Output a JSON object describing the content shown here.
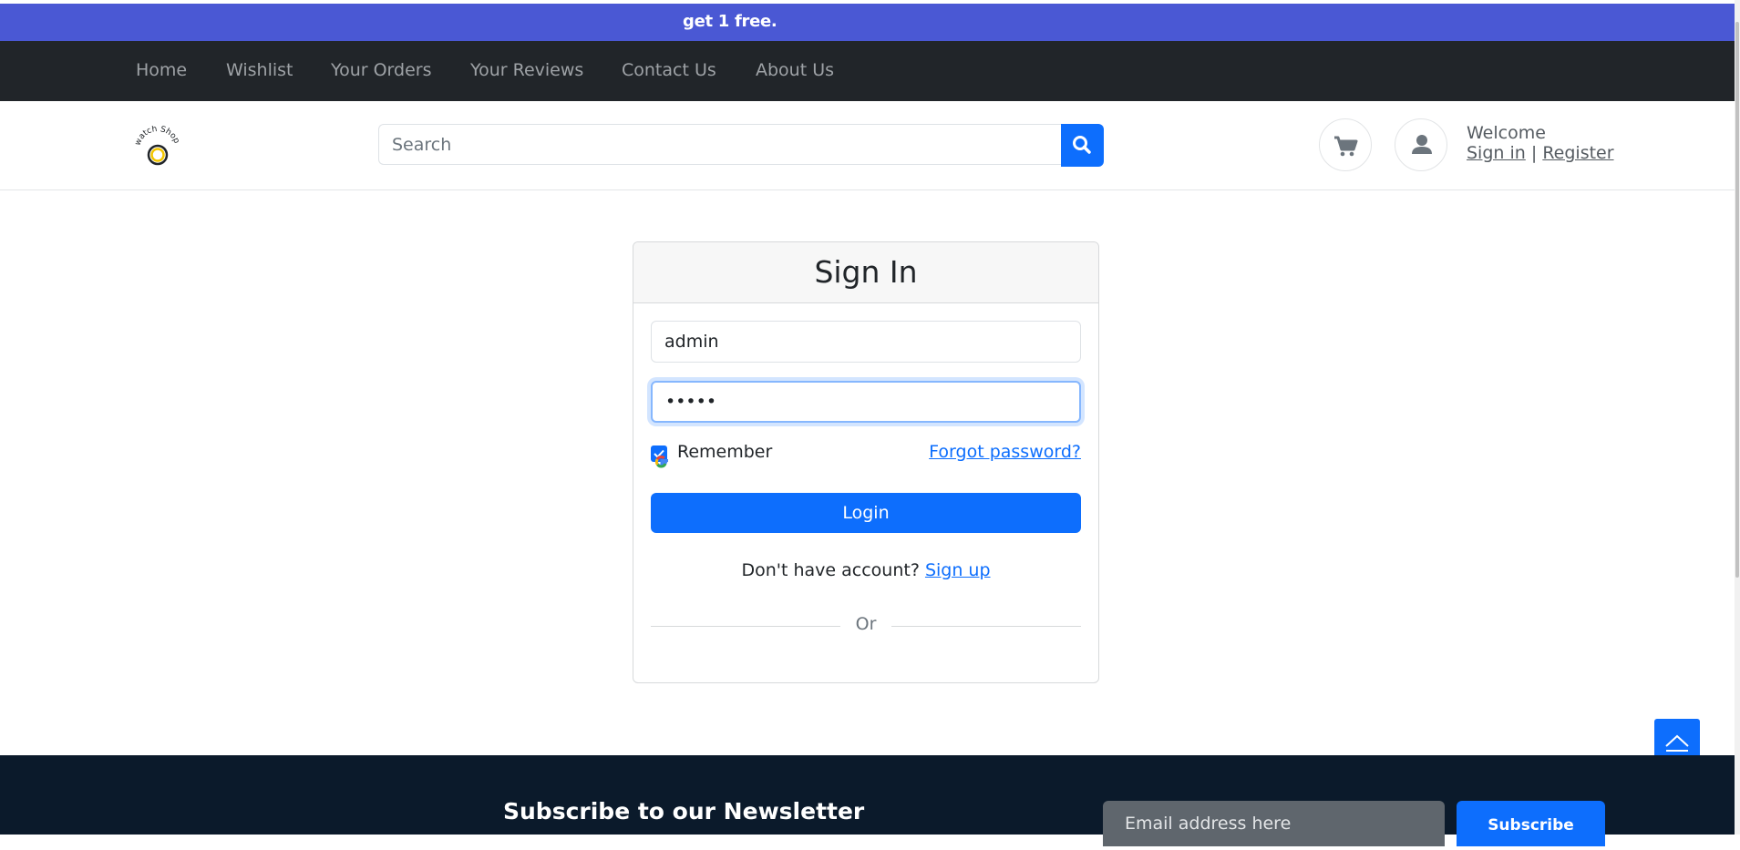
{
  "promo": {
    "text": "get 1 free."
  },
  "nav": {
    "items": [
      {
        "label": "Home"
      },
      {
        "label": "Wishlist"
      },
      {
        "label": "Your Orders"
      },
      {
        "label": "Your Reviews"
      },
      {
        "label": "Contact Us"
      },
      {
        "label": "About Us"
      }
    ]
  },
  "header": {
    "logo_text": "watch Shop",
    "search_placeholder": "Search",
    "search_icon": "search-icon",
    "cart_icon": "cart-icon",
    "user_icon": "user-icon",
    "welcome": "Welcome",
    "sign_in": "Sign in",
    "separator": "|",
    "register": "Register"
  },
  "login": {
    "title": "Sign In",
    "username_value": "admin",
    "password_value": "•••••",
    "remember_label": "Remember",
    "remember_checked": true,
    "forgot_password": "Forgot password?",
    "login_button": "Login",
    "no_account_text": "Don't have account?",
    "signup_link": "Sign up",
    "or_text": "Or"
  },
  "footer": {
    "newsletter_title": "Subscribe to our Newsletter",
    "email_placeholder": "Email address here",
    "subscribe_button": "Subscribe"
  },
  "colors": {
    "promo_bg": "#4a58d4",
    "nav_bg": "#212529",
    "primary": "#0d6efd",
    "footer_bg": "#0b1a2b"
  }
}
